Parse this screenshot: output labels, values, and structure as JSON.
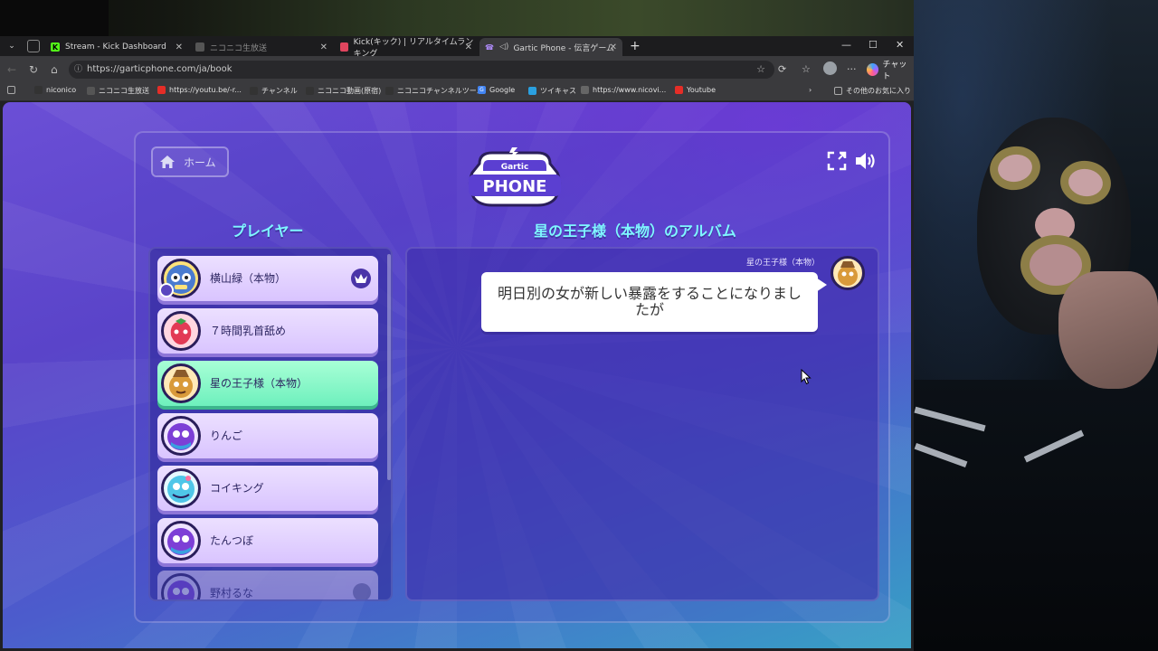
{
  "browser": {
    "tabs": [
      {
        "label": "Stream - Kick Dashboard",
        "icon_color": "#53fc18"
      },
      {
        "label": "ニコニコ生放送",
        "icon_color": "#777777"
      },
      {
        "label": "Kick(キック) | リアルタイムランキング",
        "icon_color": "#e0455e"
      },
      {
        "label": "Gartic Phone - 伝言ゲーム",
        "icon_color": "#b18cff",
        "active": true
      }
    ],
    "url": "https://garticphone.com/ja/book",
    "chat_label": "チャット",
    "bookmarks": [
      {
        "label": "niconico"
      },
      {
        "label": "ニコニコ生放送"
      },
      {
        "label": "https://youtu.be/-r..."
      },
      {
        "label": "チャンネル"
      },
      {
        "label": "ニコニコ動画(原宿)"
      },
      {
        "label": "ニコニコチャンネルツール"
      },
      {
        "label": "Google"
      },
      {
        "label": "ツイキャス"
      },
      {
        "label": "https://www.nicovi..."
      },
      {
        "label": "Youtube"
      }
    ],
    "other_bookmarks": "その他のお気に入り"
  },
  "game": {
    "home_label": "ホーム",
    "logo_top": "Gartic",
    "logo_bottom": "PHONE",
    "players_title": "プレイヤー",
    "album_title": "星の王子様（本物）のアルバム",
    "players": [
      {
        "name": "横山緑（本物）",
        "host": true,
        "you": true
      },
      {
        "name": "７時間乳首舐め"
      },
      {
        "name": "星の王子様（本物）",
        "active": true
      },
      {
        "name": "りんご"
      },
      {
        "name": "コイキング"
      },
      {
        "name": "たんつぼ"
      },
      {
        "name": "野村るな",
        "faded": true
      }
    ],
    "album": {
      "author": "星の王子様（本物）",
      "message": "明日別の女が新しい暴露をすることになりましたが"
    }
  },
  "colors": {
    "accent_title": "#7ff7ff",
    "active_player": "#6ef0bd",
    "player_card": "#e4d4ff"
  }
}
